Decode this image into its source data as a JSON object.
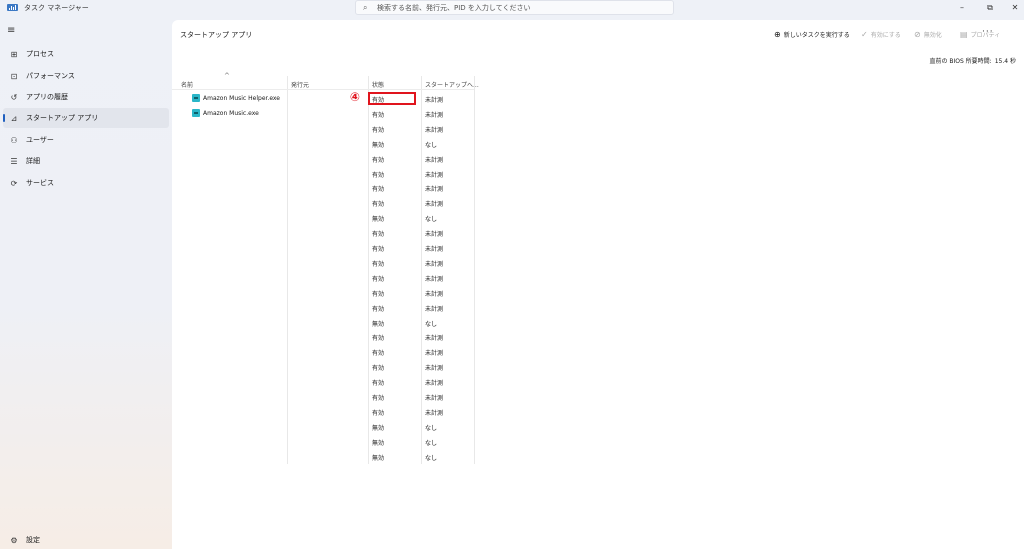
{
  "window": {
    "title": "タスク マネージャー",
    "search_placeholder": "検索する名前、発行元、PID を入力してください",
    "minimize_glyph": "–",
    "maximize_glyph": "⧉",
    "close_glyph": "✕"
  },
  "sidebar": {
    "menu_glyph": "≡",
    "items": [
      {
        "label": "プロセス",
        "icon": "processes-icon",
        "glyph": "⊞"
      },
      {
        "label": "パフォーマンス",
        "icon": "performance-icon",
        "glyph": "⊡"
      },
      {
        "label": "アプリの履歴",
        "icon": "app-history-icon",
        "glyph": "↺"
      },
      {
        "label": "スタートアップ アプリ",
        "icon": "startup-apps-icon",
        "glyph": "⊿",
        "active": true
      },
      {
        "label": "ユーザー",
        "icon": "users-icon",
        "glyph": "⚇"
      },
      {
        "label": "詳細",
        "icon": "details-icon",
        "glyph": "☰"
      },
      {
        "label": "サービス",
        "icon": "services-icon",
        "glyph": "⟳"
      }
    ],
    "settings": {
      "label": "設定",
      "icon": "settings-icon",
      "glyph": "⚙"
    }
  },
  "main": {
    "title": "スタートアップ アプリ",
    "toolbar": {
      "run_new_task": {
        "label": "新しいタスクを実行する",
        "glyph": "⊕"
      },
      "enable": {
        "label": "有効にする",
        "glyph": "✓"
      },
      "disable": {
        "label": "無効化",
        "glyph": "⊘"
      },
      "properties": {
        "label": "プロパティ",
        "glyph": "▤"
      },
      "more_glyph": "···"
    },
    "bios_label": "直前の BIOS 所要時間:",
    "bios_value": "15.4 秒"
  },
  "table": {
    "sort_glyph": "^",
    "columns": [
      "名前",
      "発行元",
      "状態",
      "スタートアップへ..."
    ],
    "rows": [
      {
        "name": "Amazon Music Helper.exe",
        "publisher": "",
        "status": "有効",
        "impact": "未計測"
      },
      {
        "name": "Amazon Music.exe",
        "publisher": "",
        "status": "有効",
        "impact": "未計測"
      },
      {
        "name": "",
        "publisher": "",
        "status": "有効",
        "impact": "未計測"
      },
      {
        "name": "",
        "publisher": "",
        "status": "無効",
        "impact": "なし"
      },
      {
        "name": "",
        "publisher": "",
        "status": "有効",
        "impact": "未計測"
      },
      {
        "name": "",
        "publisher": "",
        "status": "有効",
        "impact": "未計測"
      },
      {
        "name": "",
        "publisher": "",
        "status": "有効",
        "impact": "未計測"
      },
      {
        "name": "",
        "publisher": "",
        "status": "有効",
        "impact": "未計測"
      },
      {
        "name": "",
        "publisher": "",
        "status": "無効",
        "impact": "なし"
      },
      {
        "name": "",
        "publisher": "",
        "status": "有効",
        "impact": "未計測"
      },
      {
        "name": "",
        "publisher": "",
        "status": "有効",
        "impact": "未計測"
      },
      {
        "name": "",
        "publisher": "",
        "status": "有効",
        "impact": "未計測"
      },
      {
        "name": "",
        "publisher": "",
        "status": "有効",
        "impact": "未計測"
      },
      {
        "name": "",
        "publisher": "",
        "status": "有効",
        "impact": "未計測"
      },
      {
        "name": "",
        "publisher": "",
        "status": "有効",
        "impact": "未計測"
      },
      {
        "name": "",
        "publisher": "",
        "status": "無効",
        "impact": "なし"
      },
      {
        "name": "",
        "publisher": "",
        "status": "有効",
        "impact": "未計測"
      },
      {
        "name": "",
        "publisher": "",
        "status": "有効",
        "impact": "未計測"
      },
      {
        "name": "",
        "publisher": "",
        "status": "有効",
        "impact": "未計測"
      },
      {
        "name": "",
        "publisher": "",
        "status": "有効",
        "impact": "未計測"
      },
      {
        "name": "",
        "publisher": "",
        "status": "有効",
        "impact": "未計測"
      },
      {
        "name": "",
        "publisher": "",
        "status": "有効",
        "impact": "未計測"
      },
      {
        "name": "",
        "publisher": "",
        "status": "無効",
        "impact": "なし"
      },
      {
        "name": "",
        "publisher": "",
        "status": "無効",
        "impact": "なし"
      },
      {
        "name": "",
        "publisher": "",
        "status": "無効",
        "impact": "なし"
      }
    ]
  },
  "annotation": {
    "callout_number": "④",
    "highlight_color": "#e0141d"
  }
}
